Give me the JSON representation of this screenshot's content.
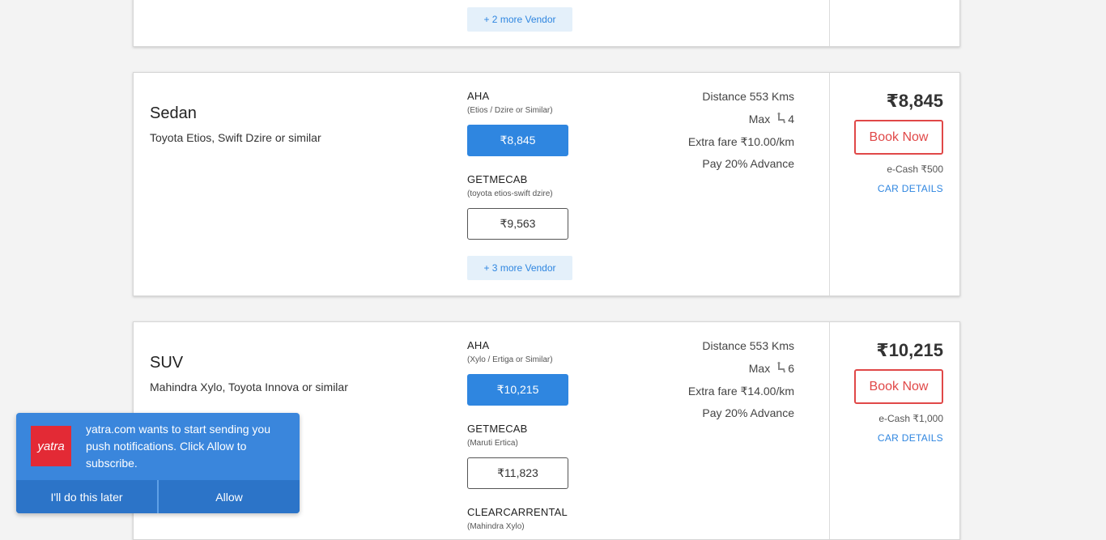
{
  "top_card": {
    "more_vendor": "+ 2 more Vendor"
  },
  "cards": [
    {
      "car_type": "Sedan",
      "car_models": "Toyota Etios, Swift Dzire or similar",
      "vendors": [
        {
          "name": "AHA",
          "sub": "(Etios / Dzire or Similar)",
          "price": "₹8,845",
          "selected": true
        },
        {
          "name": "GETMECAB",
          "sub": "(toyota etios-swift dzire)",
          "price": "₹9,563",
          "selected": false
        }
      ],
      "more_vendor": "+ 3 more Vendor",
      "distance": "Distance 553 Kms",
      "max_label": "Max",
      "seats": "4",
      "extra_fare": "Extra fare ₹10.00/km",
      "advance": "Pay 20% Advance",
      "total_price": "₹8,845",
      "book_label": "Book Now",
      "ecash": "e-Cash ₹500",
      "car_details": "CAR DETAILS"
    },
    {
      "car_type": "SUV",
      "car_models": "Mahindra Xylo, Toyota Innova or similar",
      "vendors": [
        {
          "name": "AHA",
          "sub": "(Xylo / Ertiga or Similar)",
          "price": "₹10,215",
          "selected": true
        },
        {
          "name": "GETMECAB",
          "sub": "(Maruti Ertica)",
          "price": "₹11,823",
          "selected": false
        },
        {
          "name": "CLEARCARRENTAL",
          "sub": "(Mahindra Xylo)"
        }
      ],
      "distance": "Distance 553 Kms",
      "max_label": "Max",
      "seats": "6",
      "extra_fare": "Extra fare ₹14.00/km",
      "advance": "Pay 20% Advance",
      "total_price": "₹10,215",
      "book_label": "Book Now",
      "ecash": "e-Cash ₹1,000",
      "car_details": "CAR DETAILS"
    }
  ],
  "push_notification": {
    "logo_text": "yatra",
    "message": "yatra.com wants to start sending you push notifications. Click Allow to subscribe.",
    "later_label": "I'll do this later",
    "allow_label": "Allow"
  },
  "colors": {
    "accent_blue": "#2f86e0",
    "book_red": "#e04848",
    "push_blue": "#3a86dc",
    "logo_red": "#e32a35"
  },
  "icons": {
    "seat": "seat-icon"
  }
}
